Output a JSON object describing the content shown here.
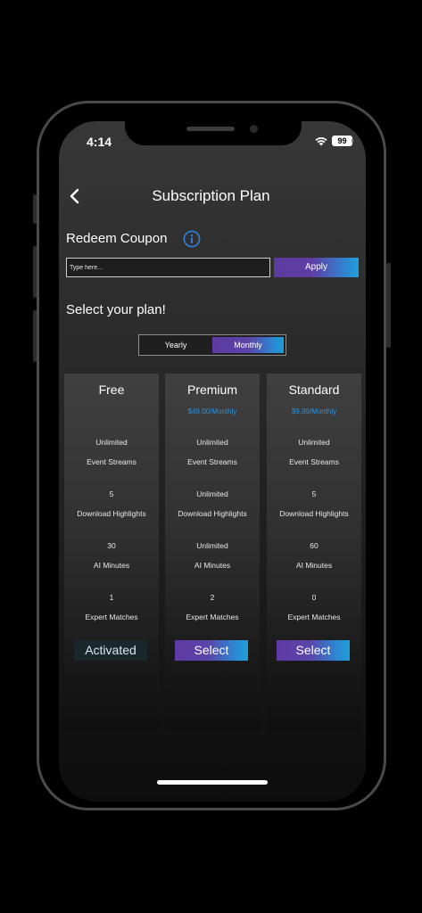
{
  "status_bar": {
    "time": "4:14",
    "battery": "99"
  },
  "header": {
    "title": "Subscription Plan"
  },
  "coupon": {
    "label": "Redeem Coupon",
    "placeholder": "Type here...",
    "apply_label": "Apply"
  },
  "plan_section": {
    "label": "Select your plan!",
    "tabs": [
      "Yearly",
      "Monthly"
    ],
    "selected_tab": "Monthly"
  },
  "plans": [
    {
      "name": "Free",
      "price": "",
      "features": [
        {
          "value": "Unlimited",
          "label": "Event Streams"
        },
        {
          "value": "5",
          "label": "Download Highlights"
        },
        {
          "value": "30",
          "label": "AI Minutes"
        },
        {
          "value": "1",
          "label": "Expert Matches"
        }
      ],
      "button": "Activated"
    },
    {
      "name": "Premium",
      "price": "$49.00/Monthly",
      "features": [
        {
          "value": "Unlimited",
          "label": "Event Streams"
        },
        {
          "value": "Unlimited",
          "label": "Download Highlights"
        },
        {
          "value": "Unlimited",
          "label": "AI Minutes"
        },
        {
          "value": "2",
          "label": "Expert Matches"
        }
      ],
      "button": "Select"
    },
    {
      "name": "Standard",
      "price": "$9.99/Monthly",
      "features": [
        {
          "value": "Unlimited",
          "label": "Event Streams"
        },
        {
          "value": "5",
          "label": "Download Highlights"
        },
        {
          "value": "60",
          "label": "AI Minutes"
        },
        {
          "value": "0",
          "label": "Expert Matches"
        }
      ],
      "button": "Select"
    }
  ],
  "colors": {
    "accent_purple": "#5e3aa2",
    "accent_blue": "#1e9fda",
    "price_blue": "#2f8fd8",
    "info_icon_blue": "#2f7fe0"
  },
  "icons": {
    "back": "chevron-left-icon",
    "info": "info-circle-icon",
    "wifi": "wifi-icon",
    "battery": "battery-icon"
  }
}
